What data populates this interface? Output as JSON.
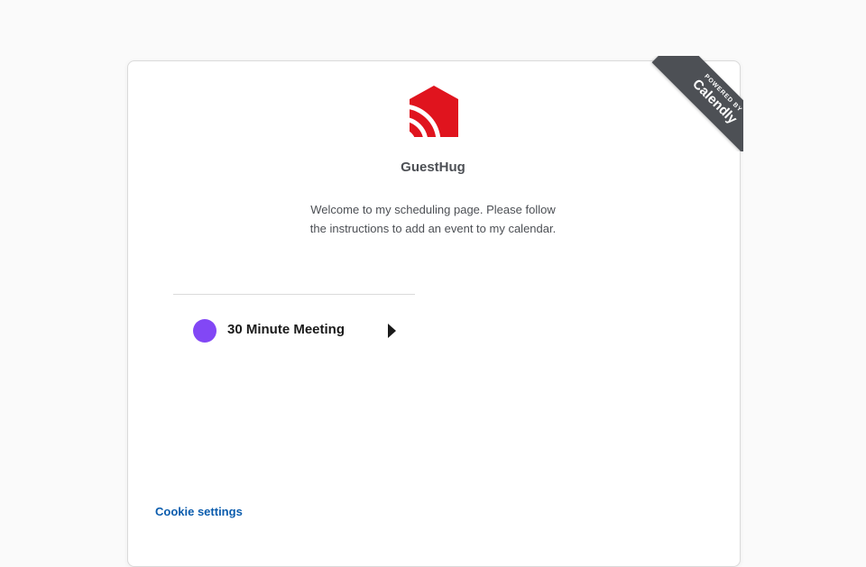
{
  "ribbon": {
    "powered_by": "POWERED BY",
    "brand": "Calendly",
    "color": "#4d5055"
  },
  "profile": {
    "logo_icon": "guesthug-logo-icon",
    "logo_color": "#e0141e",
    "name": "GuestHug",
    "welcome": "Welcome to my scheduling page. Please follow the instructions to add an event to my calendar."
  },
  "events": [
    {
      "label": "30 Minute Meeting",
      "color": "#8247f5",
      "arrow_icon": "caret-right-icon"
    }
  ],
  "footer": {
    "cookie_settings": "Cookie settings",
    "link_color": "#0b5cad"
  }
}
